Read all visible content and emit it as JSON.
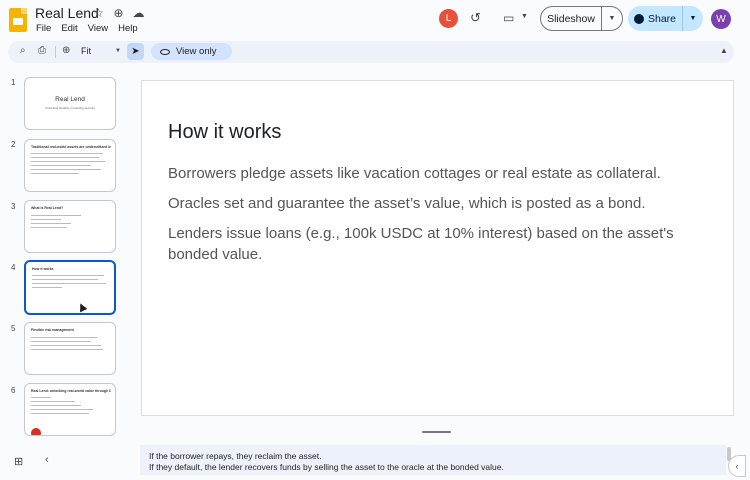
{
  "app": {
    "title": "Real Lend",
    "menus": [
      "File",
      "Edit",
      "View",
      "Help"
    ]
  },
  "header": {
    "avatar_l": "L",
    "slideshow_label": "Slideshow",
    "share_label": "Share",
    "avatar_w": "W"
  },
  "toolbar": {
    "zoom": "Fit",
    "view_only": "View only"
  },
  "filmstrip": {
    "slides": [
      {
        "num": "1",
        "title": "Real Lend",
        "subtitle": "Unlocking liquidity, protecting security"
      },
      {
        "num": "2",
        "title": "Traditional real-world assets are underutilized in DeFi"
      },
      {
        "num": "3",
        "title": "What is Real Lend?"
      },
      {
        "num": "4",
        "title": "How it works"
      },
      {
        "num": "5",
        "title": "Flexible risk management"
      },
      {
        "num": "6",
        "title": "Real Lend: unlocking real-world value through DeFi"
      }
    ]
  },
  "slide": {
    "title": "How it works",
    "bullets": [
      "Borrowers pledge assets like vacation cottages or real estate as collateral.",
      "Oracles set and guarantee the asset’s value, which is posted as a bond.",
      "Lenders issue loans (e.g., 100k USDC at 10% interest) based on the asset's bonded value."
    ]
  },
  "notes": {
    "line1": "If the borrower repays, they reclaim the asset.",
    "line2": "If they default, the lender recovers funds by selling the asset to the oracle at the bonded value."
  }
}
